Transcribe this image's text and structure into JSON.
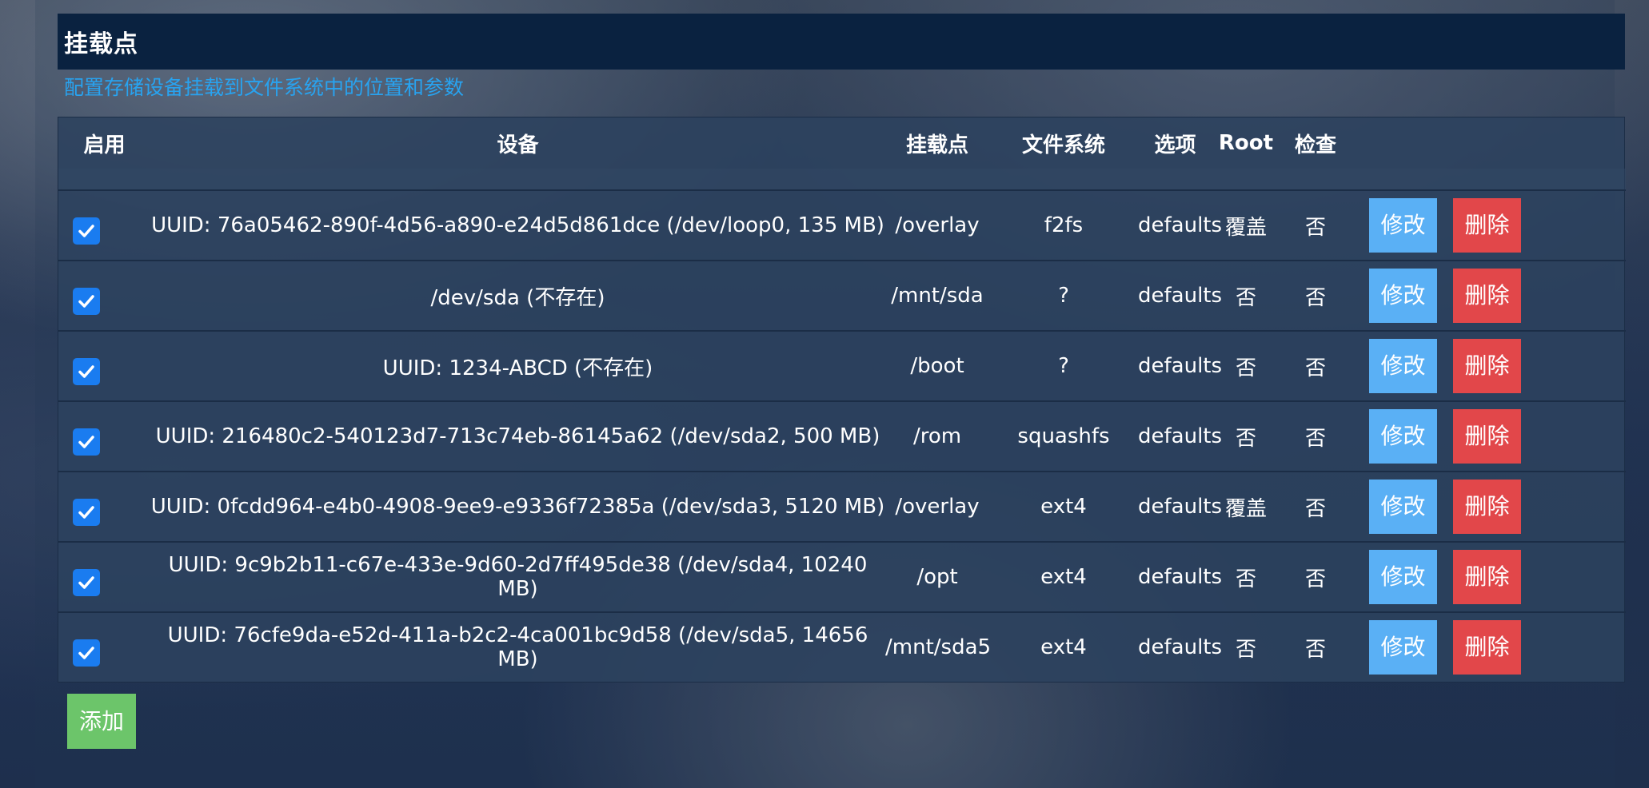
{
  "header": {
    "title": "挂载点",
    "subtitle": "配置存储设备挂载到文件系统中的位置和参数"
  },
  "table": {
    "columns": [
      "启用",
      "设备",
      "挂载点",
      "文件系统",
      "选项",
      "Root",
      "检查"
    ],
    "rows": [
      {
        "enabled": true,
        "device": "UUID: 76a05462-890f-4d56-a890-e24d5d861dce (/dev/loop0, 135 MB)",
        "mountpoint": "/overlay",
        "fs": "f2fs",
        "options": "defaults",
        "root": "覆盖",
        "check": "否"
      },
      {
        "enabled": true,
        "device": "/dev/sda (不存在)",
        "mountpoint": "/mnt/sda",
        "fs": "?",
        "options": "defaults",
        "root": "否",
        "check": "否"
      },
      {
        "enabled": true,
        "device": "UUID: 1234-ABCD (不存在)",
        "mountpoint": "/boot",
        "fs": "?",
        "options": "defaults",
        "root": "否",
        "check": "否"
      },
      {
        "enabled": true,
        "device": "UUID: 216480c2-540123d7-713c74eb-86145a62 (/dev/sda2, 500 MB)",
        "mountpoint": "/rom",
        "fs": "squashfs",
        "options": "defaults",
        "root": "否",
        "check": "否"
      },
      {
        "enabled": true,
        "device": "UUID: 0fcdd964-e4b0-4908-9ee9-e9336f72385a (/dev/sda3, 5120 MB)",
        "mountpoint": "/overlay",
        "fs": "ext4",
        "options": "defaults",
        "root": "覆盖",
        "check": "否"
      },
      {
        "enabled": true,
        "device": "UUID: 9c9b2b11-c67e-433e-9d60-2d7ff495de38 (/dev/sda4, 10240 MB)",
        "mountpoint": "/opt",
        "fs": "ext4",
        "options": "defaults",
        "root": "否",
        "check": "否"
      },
      {
        "enabled": true,
        "device": "UUID: 76cfe9da-e52d-411a-b2c2-4ca001bc9d58 (/dev/sda5, 14656 MB)",
        "mountpoint": "/mnt/sda5",
        "fs": "ext4",
        "options": "defaults",
        "root": "否",
        "check": "否"
      }
    ]
  },
  "buttons": {
    "edit": "修改",
    "delete": "删除",
    "add": "添加"
  },
  "colors": {
    "accent_blue": "#28a3f0",
    "checkbox": "#1a7cf0",
    "edit_button": "#5ab0f5",
    "delete_button": "#e2474a",
    "add_button": "#6cc56a",
    "header_bar": "#0a2240"
  },
  "icons": {
    "checkbox": "checkmark-icon"
  }
}
